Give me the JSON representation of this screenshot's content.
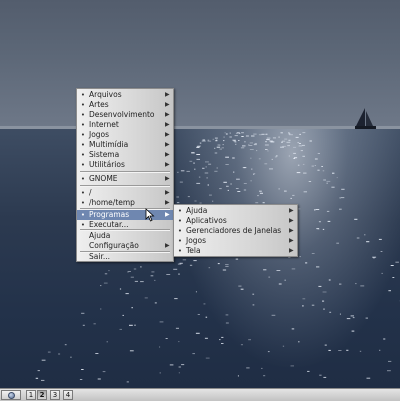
{
  "main_menu": {
    "items": [
      {
        "label": "Arquivos",
        "submenu": true
      },
      {
        "label": "Artes",
        "submenu": true
      },
      {
        "label": "Desenvolvimento",
        "submenu": true
      },
      {
        "label": "Internet",
        "submenu": true
      },
      {
        "label": "Jogos",
        "submenu": true
      },
      {
        "label": "Multimídia",
        "submenu": true
      },
      {
        "label": "Sistema",
        "submenu": true
      },
      {
        "label": "Utilitários",
        "submenu": true
      },
      {
        "label": "GNOME",
        "submenu": true
      },
      {
        "label": "/",
        "submenu": true
      },
      {
        "label": "/home/temp",
        "submenu": true
      },
      {
        "label": "Programas",
        "submenu": true
      },
      {
        "label": "Executar...",
        "submenu": false
      },
      {
        "label": "Ajuda",
        "submenu": false
      },
      {
        "label": "Configuração",
        "submenu": true
      },
      {
        "label": "Sair...",
        "submenu": false
      }
    ],
    "highlighted": "Programas"
  },
  "submenu": {
    "items": [
      {
        "label": "Ajuda",
        "submenu": true
      },
      {
        "label": "Aplicativos",
        "submenu": true
      },
      {
        "label": "Gerenciadores de Janelas",
        "submenu": true
      },
      {
        "label": "Jogos",
        "submenu": true
      },
      {
        "label": "Tela",
        "submenu": true
      }
    ]
  },
  "taskbar": {
    "workspaces": [
      "1",
      "2",
      "3",
      "4"
    ],
    "active_workspace": "2"
  },
  "icons": {
    "bullet": "•",
    "submenu_arrow": "▶",
    "start_button": "desktop-menu-icon",
    "cursor": "mouse-pointer-icon",
    "sailboat": "sailboat"
  },
  "colors": {
    "menu_highlight": "#6f87b0",
    "menu_background": "#dcdcdc",
    "taskbar": "#d4d4d4"
  }
}
